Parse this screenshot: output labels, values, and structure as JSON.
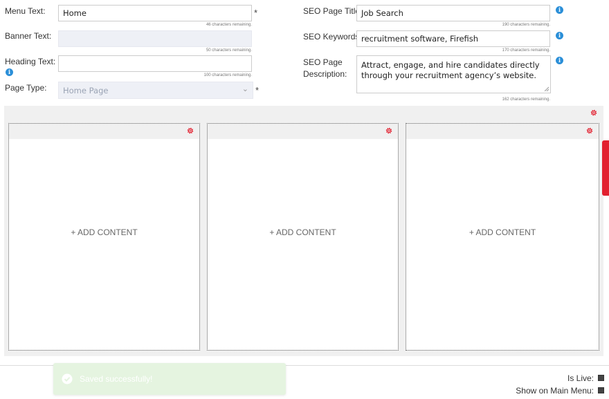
{
  "form": {
    "menu_text": {
      "label": "Menu Text:",
      "value": "Home",
      "remaining": "46 characters remaining.",
      "required": "*"
    },
    "banner_text": {
      "label": "Banner Text:",
      "value": "",
      "remaining": "50 characters remaining."
    },
    "heading_text": {
      "label": "Heading Text:",
      "value": "",
      "remaining": "100 characters remaining.",
      "info": "i"
    },
    "page_type": {
      "label": "Page Type:",
      "value": "Home Page",
      "required": "*",
      "chevron": "⌄"
    },
    "seo_title": {
      "label": "SEO Page Title:",
      "value": "Job Search",
      "remaining": "190 characters remaining.",
      "info": "i"
    },
    "seo_keywords": {
      "label": "SEO Keywords:",
      "value": "recruitment software, Firefish",
      "remaining": "170 characters remaining.",
      "info": "i"
    },
    "seo_description": {
      "label_line1": "SEO Page",
      "label_line2": "Description:",
      "value": "Attract, engage, and hire candidates directly through your recruitment agency’s website.",
      "remaining": "162 characters remaining.",
      "info": "i"
    }
  },
  "builder": {
    "columns": [
      {
        "add_label": "+ ADD CONTENT"
      },
      {
        "add_label": "+ ADD CONTENT"
      },
      {
        "add_label": "+ ADD CONTENT"
      }
    ]
  },
  "footer": {
    "is_live": {
      "label": "Is Live:",
      "checked": true
    },
    "show_main_menu": {
      "label": "Show on Main Menu:",
      "checked": true
    }
  },
  "toast": {
    "message": "Saved successfully!"
  },
  "colors": {
    "accent": "#e2202f",
    "info": "#2b8fd8",
    "toast_bg": "#e5f4e0"
  },
  "icons": [
    "info-icon",
    "gear-icon",
    "check-circle-icon",
    "chevron-down-icon",
    "resize-grip-icon",
    "checkbox-icon"
  ]
}
